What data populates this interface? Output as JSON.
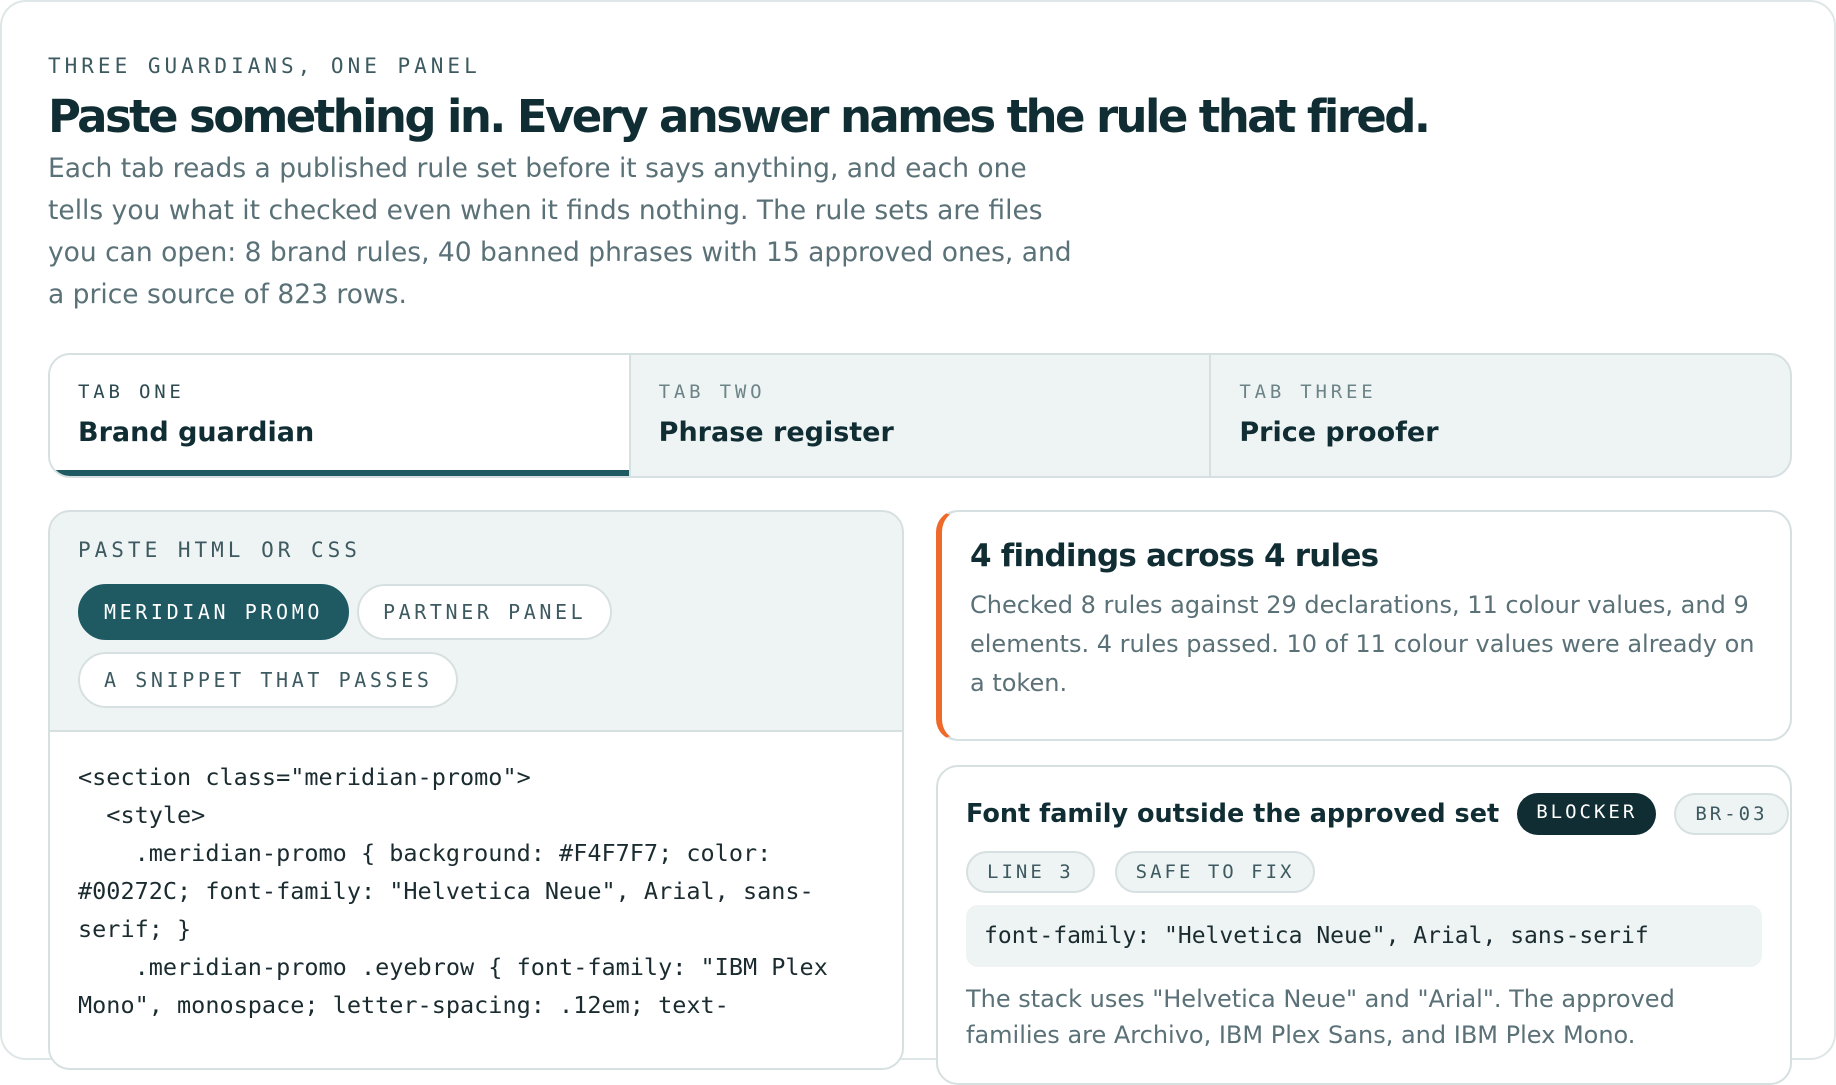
{
  "eyebrow": "THREE GUARDIANS, ONE PANEL",
  "headline": "Paste something in. Every answer names the rule that fired.",
  "lede": "Each tab reads a published rule set before it says anything, and each one tells you what it checked even when it finds nothing. The rule sets are files you can open: 8 brand rules, 40 banned phrases with 15 approved ones, and a price source of 823 rows.",
  "tabs": [
    {
      "kicker": "TAB ONE",
      "title": "Brand guardian",
      "active": true
    },
    {
      "kicker": "TAB TWO",
      "title": "Phrase register",
      "active": false
    },
    {
      "kicker": "TAB THREE",
      "title": "Price proofer",
      "active": false
    }
  ],
  "input": {
    "label": "PASTE HTML OR CSS",
    "chips": [
      "MERIDIAN PROMO",
      "PARTNER PANEL",
      "A SNIPPET THAT PASSES"
    ],
    "code_lines": [
      "<section class=\"meridian-promo\">",
      "  <style>",
      "    .meridian-promo { background: #F4F7F7; color: #00272C; font-family: \"Helvetica Neue\", Arial, sans-serif; }",
      "    .meridian-promo .eyebrow { font-family: \"IBM Plex Mono\", monospace; letter-spacing: .12em; text-"
    ]
  },
  "summary": {
    "title": "4 findings across 4 rules",
    "body": "Checked 8 rules against 29 declarations, 11 colour values, and 9 elements. 4 rules passed. 10 of 11 colour values were already on a token.",
    "accent_color": "#EF6A2A"
  },
  "finding": {
    "title": "Font family outside the approved set",
    "severity": "BLOCKER",
    "rule_id": "BR-03",
    "line": "LINE 3",
    "fix": "SAFE TO FIX",
    "snippet": "font-family: \"Helvetica Neue\", Arial, sans-serif",
    "body": "The stack uses \"Helvetica Neue\" and \"Arial\". The approved families are Archivo, IBM Plex Sans, and IBM Plex Mono."
  },
  "colors": {
    "primary": "#1F5A63",
    "ink": "#0F2D33",
    "accent": "#EF6A2A",
    "panel": "#EEF3F3"
  }
}
